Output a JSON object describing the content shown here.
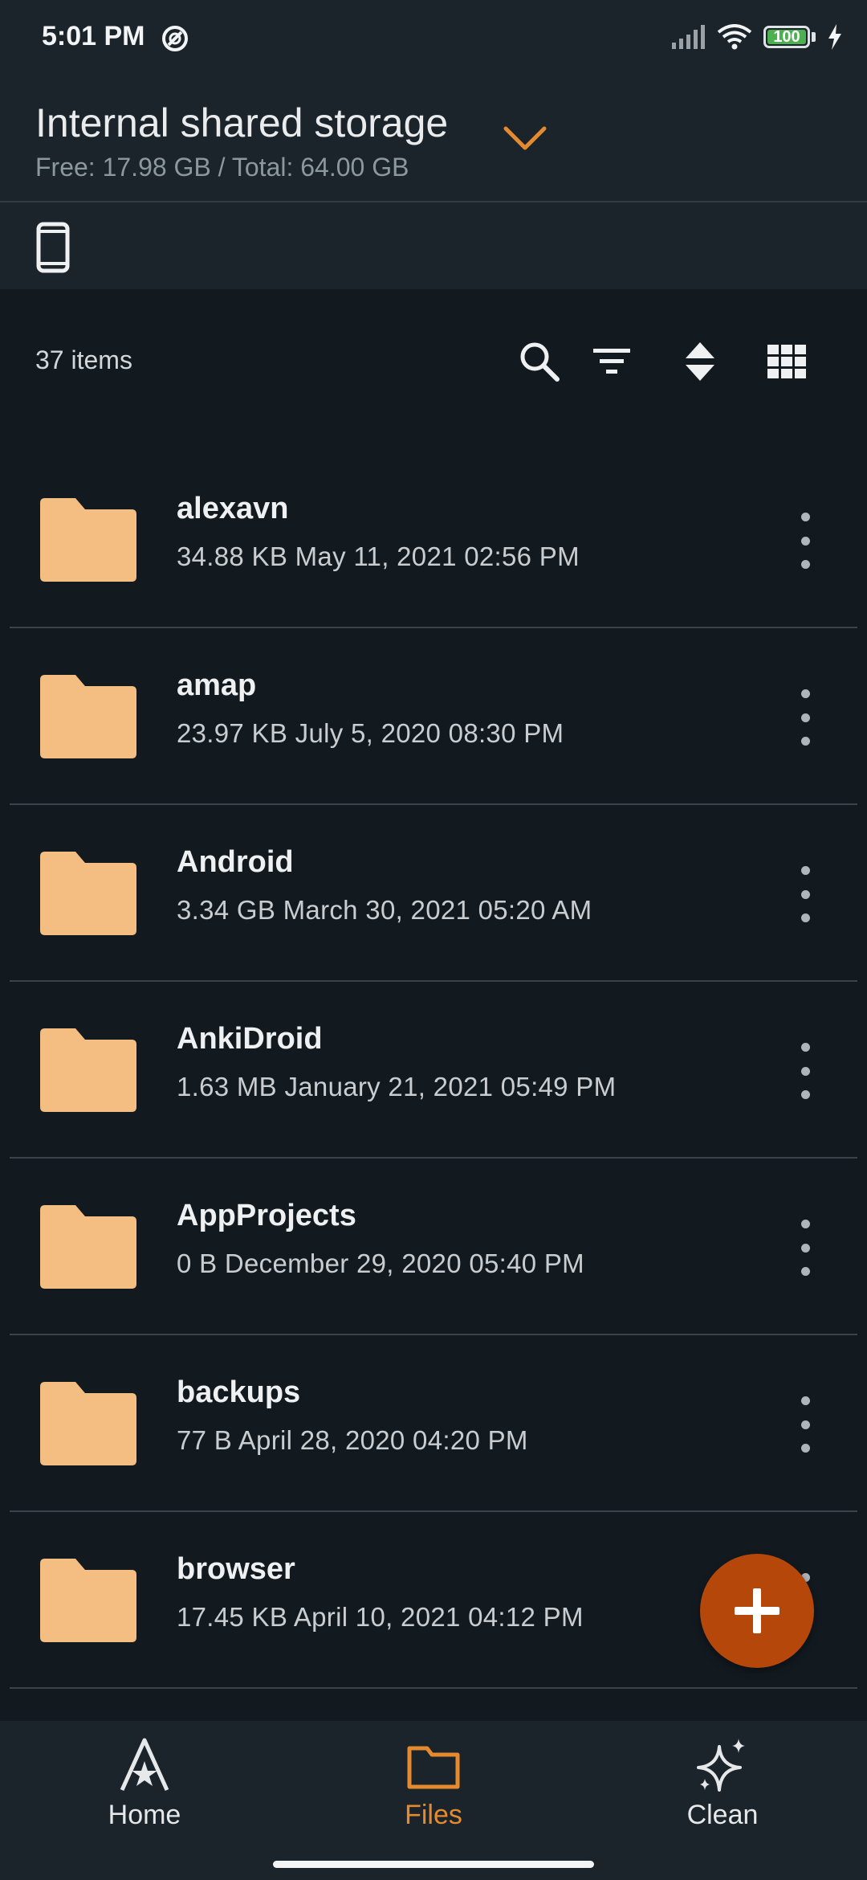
{
  "status": {
    "time": "5:01 PM",
    "battery": "100"
  },
  "header": {
    "title": "Internal shared storage",
    "subtitle": "Free: 17.98 GB / Total: 64.00 GB"
  },
  "toolbar": {
    "items_count": "37 items"
  },
  "files": [
    {
      "name": "alexavn",
      "meta": "34.88 KB May 11, 2021 02:56 PM"
    },
    {
      "name": "amap",
      "meta": "23.97 KB July 5, 2020 08:30 PM"
    },
    {
      "name": "Android",
      "meta": "3.34 GB March 30, 2021 05:20 AM"
    },
    {
      "name": "AnkiDroid",
      "meta": "1.63 MB January 21, 2021 05:49 PM"
    },
    {
      "name": "AppProjects",
      "meta": "0 B December 29, 2020 05:40 PM"
    },
    {
      "name": "backups",
      "meta": "77 B April 28, 2020 04:20 PM"
    },
    {
      "name": "browser",
      "meta": "17.45 KB April 10, 2021 04:12 PM"
    }
  ],
  "nav": {
    "items": [
      {
        "label": "Home",
        "icon": "home-icon"
      },
      {
        "label": "Files",
        "icon": "folder-icon",
        "active": true
      },
      {
        "label": "Clean",
        "icon": "sparkle-icon"
      }
    ]
  },
  "colors": {
    "accent": "#e58a2e",
    "folder": "#f4bd82",
    "fab": "#b5470b",
    "background": "#121a20",
    "surface": "#1b242b"
  }
}
